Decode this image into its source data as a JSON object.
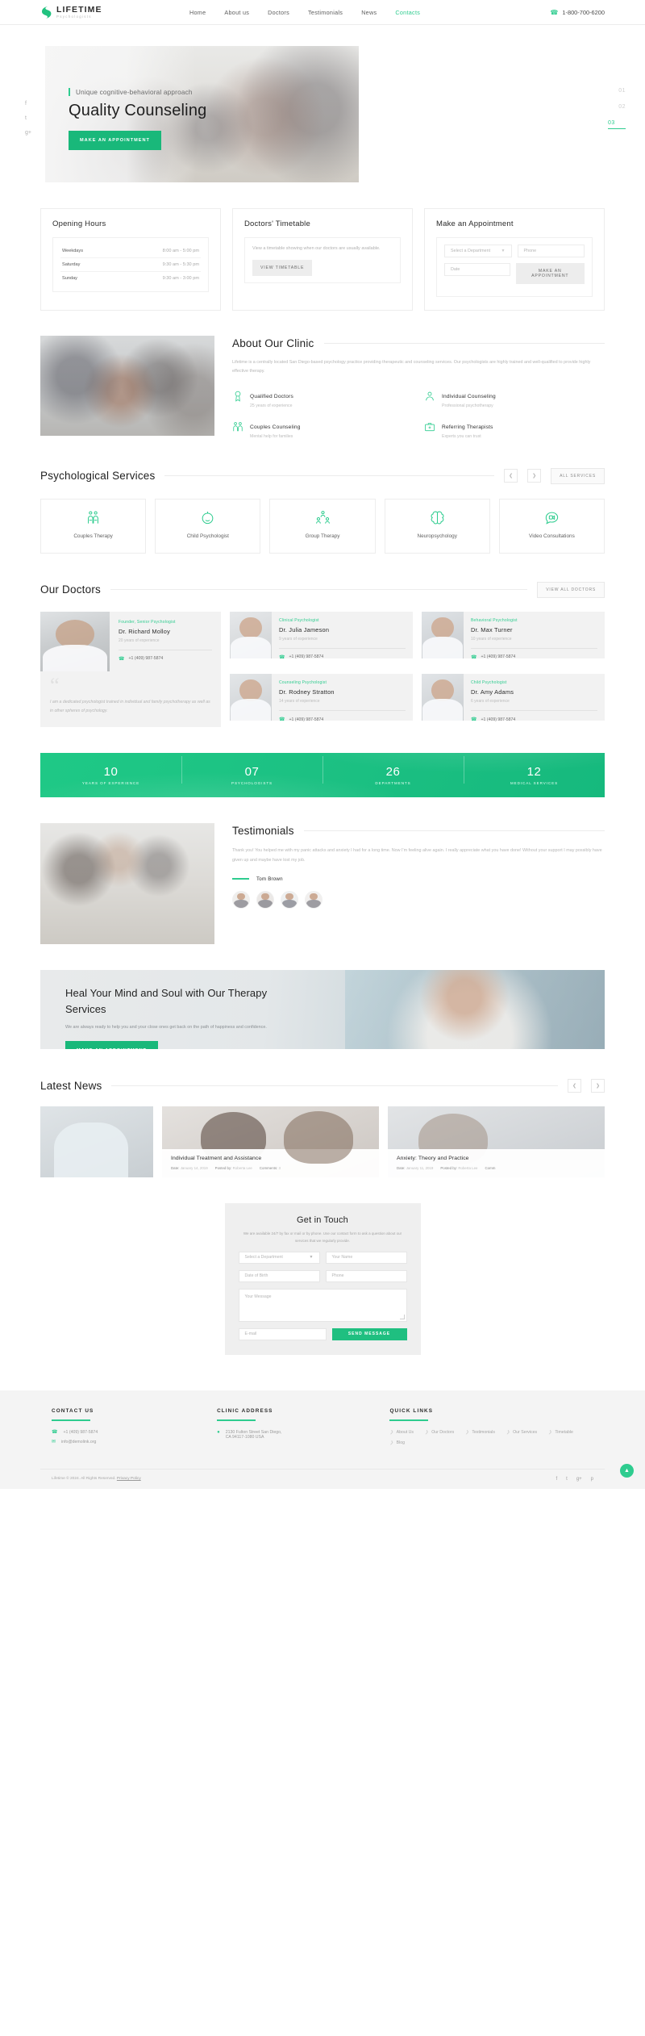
{
  "header": {
    "logo_name": "LIFETIME",
    "logo_sub": "Psychologists",
    "nav": [
      {
        "label": "Home",
        "active": false
      },
      {
        "label": "About us",
        "active": false
      },
      {
        "label": "Doctors",
        "active": false
      },
      {
        "label": "Testimonials",
        "active": false
      },
      {
        "label": "News",
        "active": false
      },
      {
        "label": "Contacts",
        "active": true
      }
    ],
    "phone": "1-800-700-6200",
    "phone_icon": "phone-icon"
  },
  "hero": {
    "kicker": "Unique cognitive-behavioral approach",
    "title": "Quality Counseling",
    "cta": "MAKE AN APPOINTMENT",
    "social": [
      "f",
      "t",
      "g+"
    ],
    "slides": [
      "01",
      "02",
      "03"
    ],
    "active_slide": "03"
  },
  "opening_hours": {
    "title": "Opening Hours",
    "rows": [
      {
        "day": "Weekdays",
        "time": "8:00 am - 5:00 pm"
      },
      {
        "day": "Saturday",
        "time": "9:30 am - 5:30 pm"
      },
      {
        "day": "Sunday",
        "time": "9:30 am - 3:00 pm"
      }
    ]
  },
  "timetable": {
    "title": "Doctors' Timetable",
    "note": "View a timetable showing when our doctors are usually available.",
    "button": "VIEW TIMETABLE"
  },
  "appointment": {
    "title": "Make an Appointment",
    "department_placeholder": "Select a Department",
    "phone_placeholder": "Phone",
    "date_placeholder": "Date",
    "button": "MAKE AN APPOINTMENT"
  },
  "about": {
    "title": "About Our Clinic",
    "text": "Lifetime is a centrally located San Diego-based psychology practice providing therapeutic and counseling services. Our psychologists are highly trained and well-qualified to provide highly effective therapy.",
    "features": [
      {
        "icon": "medal-icon",
        "title": "Qualified Doctors",
        "sub": "25 years of experience"
      },
      {
        "icon": "person-icon",
        "title": "Individual Counseling",
        "sub": "Professional psychotherapy"
      },
      {
        "icon": "family-icon",
        "title": "Couples Counseling",
        "sub": "Mental help for families"
      },
      {
        "icon": "briefcase-icon",
        "title": "Referring Therapists",
        "sub": "Experts you can trust"
      }
    ]
  },
  "services": {
    "title": "Psychological Services",
    "all_button": "ALL SERVICES",
    "prev_icon": "chevron-left-icon",
    "next_icon": "chevron-right-icon",
    "items": [
      {
        "icon": "couple-icon",
        "label": "Couples Therapy"
      },
      {
        "icon": "child-face-icon",
        "label": "Child Psychologist"
      },
      {
        "icon": "group-icon",
        "label": "Group Therapy"
      },
      {
        "icon": "brain-icon",
        "label": "Neuropsychology"
      },
      {
        "icon": "video-chat-icon",
        "label": "Video Consultations"
      }
    ]
  },
  "doctors": {
    "title": "Our Doctors",
    "all_button": "VIEW ALL DOCTORS",
    "featured": {
      "role": "Founder, Senior Psychologist",
      "name": "Dr. Richard Molloy",
      "experience": "20 years of experience",
      "phone": "+1 (409) 987-5874",
      "quote": "I am a dedicated psychologist trained in individual and family psychotherapy as well as in other spheres of psychology."
    },
    "list": [
      {
        "role": "Clinical Psychologist",
        "name": "Dr. Julia Jameson",
        "experience": "9 years of experience",
        "phone": "+1 (409) 987-5874"
      },
      {
        "role": "Behavioral Psychologist",
        "name": "Dr. Max Turner",
        "experience": "10 years of experience",
        "phone": "+1 (409) 987-5874"
      },
      {
        "role": "Counseling Psychologist",
        "name": "Dr. Rodney Stratton",
        "experience": "14 years of experience",
        "phone": "+1 (409) 987-5874"
      },
      {
        "role": "Child Psychologist",
        "name": "Dr. Amy Adams",
        "experience": "6 years of experience",
        "phone": "+1 (409) 987-5874"
      }
    ]
  },
  "stats": [
    {
      "number": "10",
      "label": "YEARS OF EXPERIENCE"
    },
    {
      "number": "07",
      "label": "PSYCHOLOGISTS"
    },
    {
      "number": "26",
      "label": "DEPARTMENTS"
    },
    {
      "number": "12",
      "label": "MEDICAL SERVICES"
    }
  ],
  "testimonials": {
    "title": "Testimonials",
    "text": "Thank you! You helped me with my panic attacks and anxiety I had for a long time. Now I'm feeling alive again. I really appreciate what you have done! Without your support I may possibly have given up and maybe have lost my job.",
    "author": "Tom Brown",
    "avatar_count": 4
  },
  "cta": {
    "title": "Heal Your Mind and Soul with Our Therapy Services",
    "sub": "We are always ready to help you and your close ones get back on the path of happiness and confidence.",
    "button": "MAKE AN APPOINTMENT"
  },
  "news": {
    "title": "Latest News",
    "prev_icon": "chevron-left-icon",
    "next_icon": "chevron-right-icon",
    "items": [
      {
        "title": "",
        "date_label": "",
        "date": "",
        "posted_label": "",
        "author": "",
        "comments_label": "",
        "comments": ""
      },
      {
        "title": "Individual Treatment and Assistance",
        "date_label": "Date:",
        "date": "January 14, 2019",
        "posted_label": "Posted by:",
        "author": "Roberta Lee",
        "comments_label": "Comments:",
        "comments": "3"
      },
      {
        "title": "Anxiety: Theory and Practice",
        "date_label": "Date:",
        "date": "January 11, 2019",
        "posted_label": "Posted by:",
        "author": "Roberta Lee",
        "comments_label": "Comm",
        "comments": ""
      }
    ]
  },
  "contact": {
    "title": "Get in Touch",
    "lead": "We are available 24/7 by fax or mail or by phone. Use our contact form to ask a question about our services that we regularly provide.",
    "department_placeholder": "Select a Department",
    "name_placeholder": "Your Name",
    "dob_placeholder": "Date of Birth",
    "phone_placeholder": "Phone",
    "message_placeholder": "Your Message",
    "email_placeholder": "E-mail",
    "send_button": "SEND MESSAGE"
  },
  "footer": {
    "contact_title": "CONTACT US",
    "phone": "+1 (409) 987-5874",
    "email": "info@demolink.org",
    "phone_icon": "phone-icon",
    "email_icon": "envelope-icon",
    "address_title": "CLINIC ADDRESS",
    "address_icon": "map-pin-icon",
    "address_line1": "2130 Fulton Street San Diego,",
    "address_line2": "CA 94117-1080 USA",
    "links_title": "QUICK LINKS",
    "links": [
      "About Us",
      "Our Doctors",
      "Testimonials",
      "Our Services",
      "Timetable",
      "Blog"
    ],
    "copyright": "Lifetime © 2024. All Rights Reserved.",
    "copyright_link": "Privacy Policy",
    "socials": [
      "f",
      "t",
      "g+",
      "p"
    ],
    "scroll_top_icon": "chevron-up-icon"
  }
}
